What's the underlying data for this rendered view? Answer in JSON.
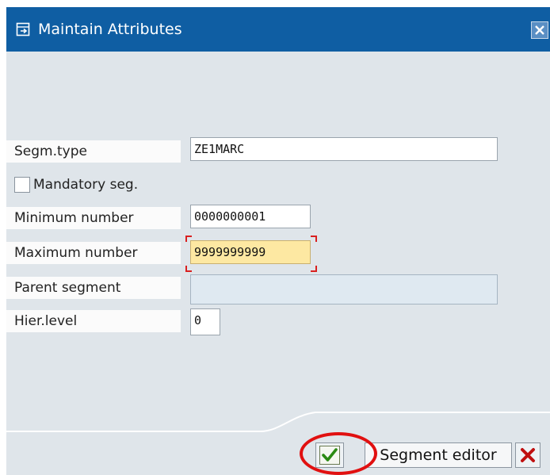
{
  "dialog": {
    "title": "Maintain Attributes",
    "title_icon": "dialog-icon",
    "close_icon": "close-icon",
    "colors": {
      "title_bar": "#0f5ea3",
      "body": "#dfe5ea",
      "required_field": "#fde8a2",
      "highlight": "#e11010"
    }
  },
  "form": {
    "segm_type": {
      "label": "Segm.type",
      "value": "ZE1MARC"
    },
    "mandatory": {
      "label": "Mandatory seg.",
      "checked": false
    },
    "min_number": {
      "label": "Minimum number",
      "value": "0000000001"
    },
    "max_number": {
      "label": "Maximum number",
      "value": "9999999999"
    },
    "parent_segment": {
      "label": "Parent segment",
      "value": ""
    },
    "hier_level": {
      "label": "Hier.level",
      "value": "0"
    }
  },
  "footer": {
    "ok_icon": "checkmark-icon",
    "segment_editor_label": "Segment editor",
    "cancel_icon": "cancel-x-icon"
  }
}
